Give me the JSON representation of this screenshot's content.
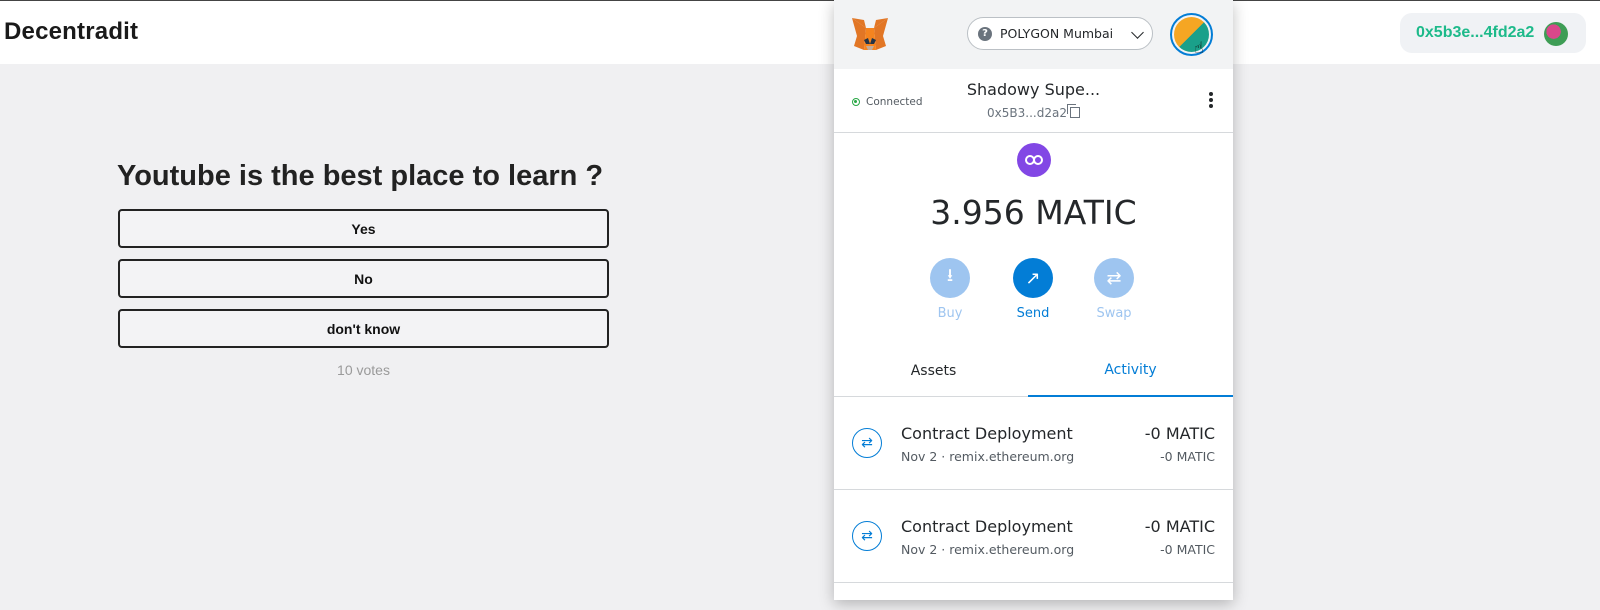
{
  "app": {
    "brand": "Decentradit",
    "account_pill": "0x5b3e...4fd2a2"
  },
  "poll": {
    "question": "Youtube is the best place to learn ?",
    "options": [
      "Yes",
      "No",
      "don't know"
    ],
    "votes": "10 votes"
  },
  "metamask": {
    "network": "POLYGON Mumbai",
    "status": "Connected",
    "account_name": "Shadowy Supe...",
    "account_address": "0x5B3...d2a2",
    "balance": "3.956 MATIC",
    "actions": [
      "Buy",
      "Send",
      "Swap"
    ],
    "tabs": [
      "Assets",
      "Activity"
    ],
    "active_tab": "Activity",
    "transactions": [
      {
        "title": "Contract Deployment",
        "subtitle": "Nov 2 · remix.ethereum.org",
        "amount": "-0 MATIC",
        "amount_sub": "-0 MATIC"
      },
      {
        "title": "Contract Deployment",
        "subtitle": "Nov 2 · remix.ethereum.org",
        "amount": "-0 MATIC",
        "amount_sub": "-0 MATIC"
      }
    ],
    "colors": {
      "primary": "#037dd6",
      "polygon": "#8247e5",
      "connected": "#28a745"
    }
  }
}
